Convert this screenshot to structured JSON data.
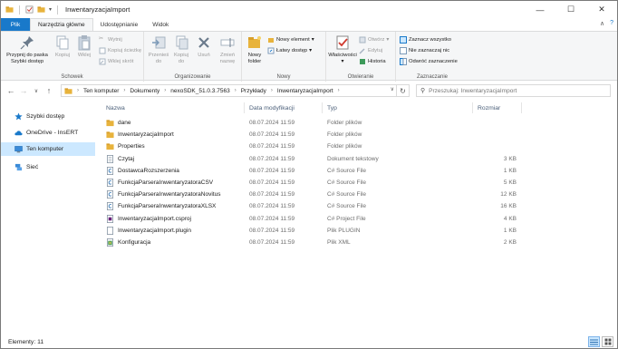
{
  "window": {
    "title": "InwentaryzacjaImport",
    "controls": [
      "minimize",
      "maximize",
      "close"
    ]
  },
  "ribbon_tabs": [
    {
      "label": "Plik"
    },
    {
      "label": "Narzędzia główne"
    },
    {
      "label": "Udostępnianie"
    },
    {
      "label": "Widok"
    }
  ],
  "ribbon": {
    "clipboard": {
      "pin_label": "Przypnij do paska Szybki dostęp",
      "copy_label": "Kopiuj",
      "paste_label": "Wklej",
      "cut_label": "Wytnij",
      "copy_path_label": "Kopiuj ścieżkę",
      "paste_shortcut_label": "Wklej skrót",
      "group_label": "Schowek"
    },
    "organize": {
      "move_to_label": "Przenieś do",
      "copy_to_label": "Kopiuj do",
      "delete_label": "Usuń",
      "rename_label": "Zmień nazwę",
      "group_label": "Organizowanie"
    },
    "new": {
      "new_folder_label": "Nowy folder",
      "new_item_label": "Nowy element",
      "easy_access_label": "Łatwy dostęp",
      "group_label": "Nowy"
    },
    "open": {
      "properties_label": "Właściwości",
      "open_label": "Otwórz",
      "edit_label": "Edytuj",
      "history_label": "Historia",
      "group_label": "Otwieranie"
    },
    "select": {
      "select_all_label": "Zaznacz wszystko",
      "select_none_label": "Nie zaznaczaj nic",
      "invert_label": "Odwróć zaznaczenie",
      "group_label": "Zaznaczanie"
    }
  },
  "address": {
    "crumbs": [
      "Ten komputer",
      "Dokumenty",
      "nexoSDK_51.0.3.7563",
      "Przykłady",
      "InwentaryzacjaImport"
    ],
    "search_placeholder": "Przeszukaj: InwentaryzacjaImport"
  },
  "nav_pane": {
    "items": [
      {
        "label": "Szybki dostęp",
        "icon": "star-icon"
      },
      {
        "label": "OneDrive - InsERT",
        "icon": "cloud-icon"
      },
      {
        "label": "Ten komputer",
        "icon": "computer-icon",
        "selected": true
      },
      {
        "label": "Sieć",
        "icon": "network-icon"
      }
    ]
  },
  "columns": {
    "name": "Nazwa",
    "date": "Data modyfikacji",
    "type": "Typ",
    "size": "Rozmiar"
  },
  "files": [
    {
      "name": "dane",
      "date": "08.07.2024 11:59",
      "type": "Folder plików",
      "size": "",
      "icon": "folder-icon"
    },
    {
      "name": "InwentaryzacjaImport",
      "date": "08.07.2024 11:59",
      "type": "Folder plików",
      "size": "",
      "icon": "folder-icon"
    },
    {
      "name": "Properties",
      "date": "08.07.2024 11:59",
      "type": "Folder plików",
      "size": "",
      "icon": "folder-icon"
    },
    {
      "name": "Czytaj",
      "date": "08.07.2024 11:59",
      "type": "Dokument tekstowy",
      "size": "3 KB",
      "icon": "text-file-icon"
    },
    {
      "name": "DostawcaRozszerzenia",
      "date": "08.07.2024 11:59",
      "type": "C# Source File",
      "size": "1 KB",
      "icon": "csharp-file-icon"
    },
    {
      "name": "FunkcjaParseraInwentaryzatoraCSV",
      "date": "08.07.2024 11:59",
      "type": "C# Source File",
      "size": "5 KB",
      "icon": "csharp-file-icon"
    },
    {
      "name": "FunkcjaParseraInwentaryzatoraNovitus",
      "date": "08.07.2024 11:59",
      "type": "C# Source File",
      "size": "12 KB",
      "icon": "csharp-file-icon"
    },
    {
      "name": "FunkcjaParseraInwentaryzatoraXLSX",
      "date": "08.07.2024 11:59",
      "type": "C# Source File",
      "size": "16 KB",
      "icon": "csharp-file-icon"
    },
    {
      "name": "InwentaryzacjaImport.csproj",
      "date": "08.07.2024 11:59",
      "type": "C# Project File",
      "size": "4 KB",
      "icon": "csproj-file-icon"
    },
    {
      "name": "InwentaryzacjaImport.plugin",
      "date": "08.07.2024 11:59",
      "type": "Plik PLUGIN",
      "size": "1 KB",
      "icon": "generic-file-icon"
    },
    {
      "name": "Konfiguracja",
      "date": "08.07.2024 11:59",
      "type": "Plik XML",
      "size": "2 KB",
      "icon": "xml-file-icon"
    }
  ],
  "status": {
    "items_label": "Elementy: 11"
  },
  "colors": {
    "file_tab": "#1979ca",
    "selection": "#cce8ff",
    "folder": "#e8b33c"
  }
}
